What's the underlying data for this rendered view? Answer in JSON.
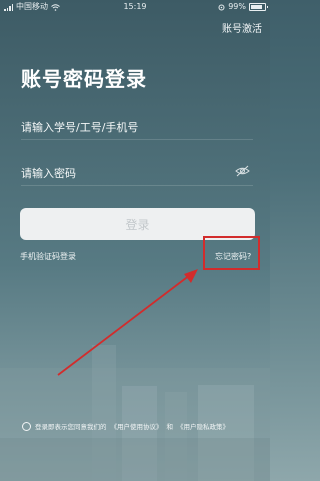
{
  "status_bar": {
    "carrier": "中国移动",
    "time": "15:19",
    "battery": "99%"
  },
  "header": {
    "activate_link": "账号激活"
  },
  "login": {
    "title": "账号密码登录",
    "username_placeholder": "请输入学号/工号/手机号",
    "password_placeholder": "请输入密码",
    "login_button": "登录",
    "sms_login": "手机验证码登录",
    "forgot_password": "忘记密码?"
  },
  "agreement": {
    "prefix": "登录即表示您同意我们的",
    "user_agreement": "《用户使用协议》",
    "and": "和",
    "privacy_policy": "《用户隐私政策》"
  },
  "icons": {
    "wifi": "wifi-icon",
    "signal": "signal-icon",
    "battery": "battery-icon",
    "eye": "eye-off-icon",
    "checkbox": "radio-circle-icon",
    "arrow": "annotation-arrow"
  },
  "colors": {
    "annotation": "#d22c2c",
    "login_button_bg": "#eef0f1",
    "login_button_text": "#c3c8cb"
  }
}
